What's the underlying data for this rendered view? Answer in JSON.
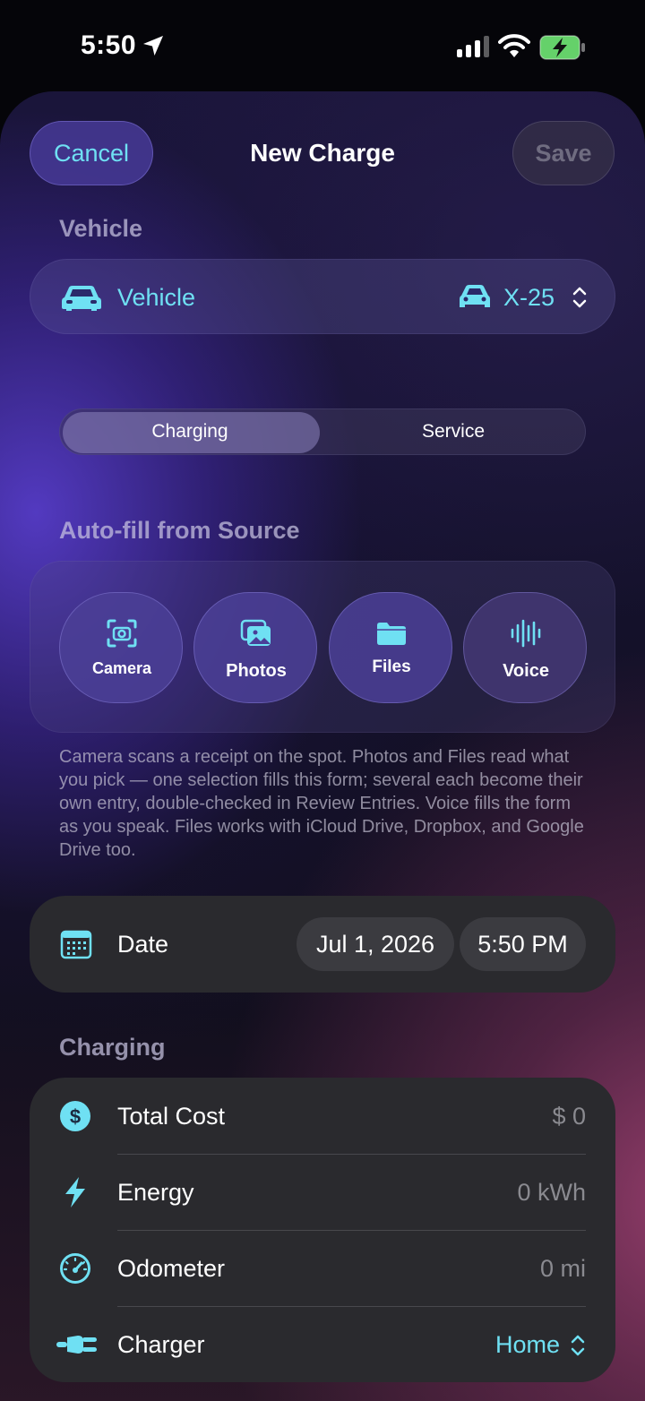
{
  "status_bar": {
    "time": "5:50"
  },
  "header": {
    "cancel_label": "Cancel",
    "title": "New Charge",
    "save_label": "Save"
  },
  "vehicle_section": {
    "heading": "Vehicle",
    "row_label": "Vehicle",
    "selected_vehicle": "X-25"
  },
  "segmented": {
    "options": [
      "Charging",
      "Service"
    ],
    "selected": "Charging"
  },
  "autofill": {
    "heading": "Auto-fill from Source",
    "sources": [
      {
        "label": "Camera",
        "icon": "camera-scan-icon"
      },
      {
        "label": "Photos",
        "icon": "photos-icon"
      },
      {
        "label": "Files",
        "icon": "folder-icon"
      },
      {
        "label": "Voice",
        "icon": "waveform-icon"
      }
    ],
    "helper_text": "Camera scans a receipt on the spot. Photos and Files read what you pick — one selection fills this form; several each become their own entry, double-checked in Review Entries. Voice fills the form as you speak. Files works with iCloud Drive, Dropbox, and Google Drive too."
  },
  "date_row": {
    "label": "Date",
    "date_value": "Jul 1, 2026",
    "time_value": "5:50 PM"
  },
  "charging_section": {
    "heading": "Charging",
    "rows": [
      {
        "label": "Total Cost",
        "value": "$ 0",
        "icon": "dollar-circle-icon"
      },
      {
        "label": "Energy",
        "value": "0 kWh",
        "icon": "bolt-icon"
      },
      {
        "label": "Odometer",
        "value": "0 mi",
        "icon": "gauge-icon"
      },
      {
        "label": "Charger",
        "value": "Home",
        "icon": "plug-icon"
      }
    ]
  },
  "colors": {
    "accent": "#6fe0f3",
    "card_bg": "#2a2a2e"
  }
}
